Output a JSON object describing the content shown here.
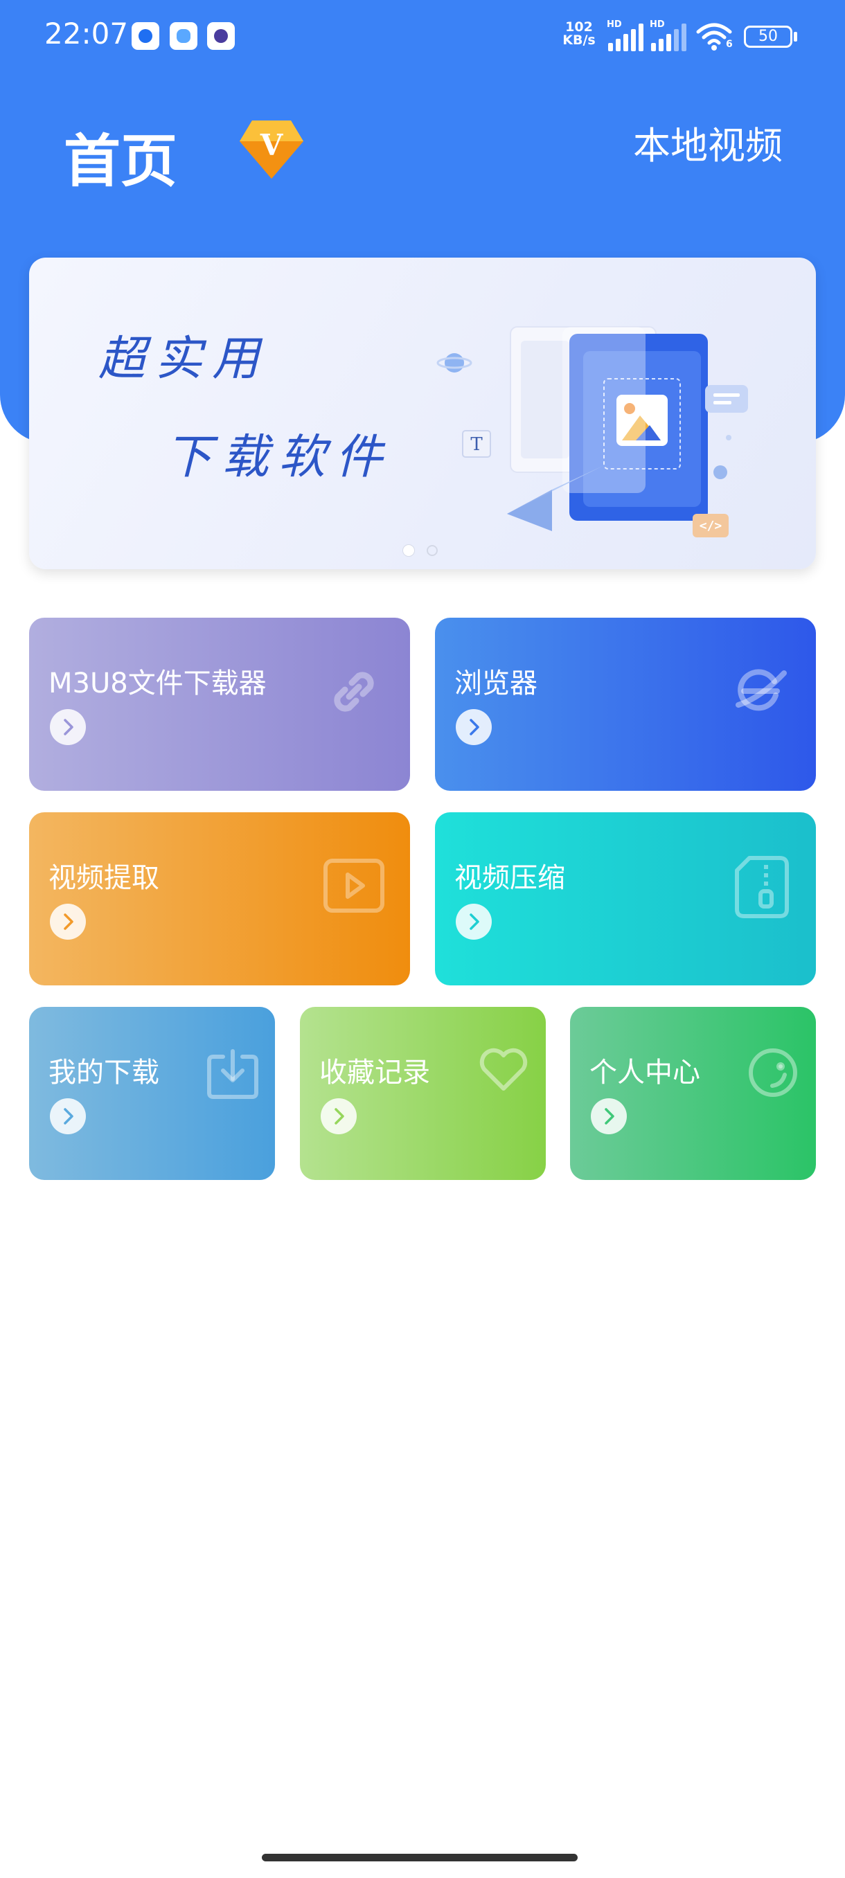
{
  "status_bar": {
    "time": "22:07",
    "net_speed_value": "102",
    "net_speed_unit": "KB/s",
    "sim1_label": "HD",
    "sim2_label": "HD",
    "wifi_label": "6",
    "battery": "50",
    "app_icons": [
      "blue-circle-app-icon",
      "cloud-app-icon",
      "purple-app-icon"
    ]
  },
  "header": {
    "title": "首页",
    "vip_label": "V",
    "local_video_label": "本地视频"
  },
  "banner": {
    "line1": "超实用",
    "line2": "下载软件",
    "art_t_label": "T",
    "art_code_label": "</>",
    "page_count": 2,
    "active_page": 1
  },
  "cards": {
    "m3u8": {
      "label": "M3U8文件下载器",
      "icon": "link-icon"
    },
    "browser": {
      "label": "浏览器",
      "icon": "browser-icon"
    },
    "extract": {
      "label": "视频提取",
      "icon": "play-icon"
    },
    "compress": {
      "label": "视频压缩",
      "icon": "zip-icon"
    },
    "downloads": {
      "label": "我的下载",
      "icon": "download-icon"
    },
    "favorites": {
      "label": "收藏记录",
      "icon": "heart-icon"
    },
    "profile": {
      "label": "个人中心",
      "icon": "smile-icon"
    }
  },
  "colors": {
    "primary": "#3b82f6",
    "m3u8": [
      "#b1aedf",
      "#8c85d3"
    ],
    "browser": [
      "#4a90ed",
      "#2e58ea"
    ],
    "extract": [
      "#f3b660",
      "#f08d0e"
    ],
    "compress": [
      "#1fe0da",
      "#1bbfcc"
    ],
    "downloads": [
      "#7fbadf",
      "#4aa0dd"
    ],
    "favorites": [
      "#b4e28f",
      "#87d146"
    ],
    "profile": [
      "#6ccb98",
      "#2bc467"
    ]
  }
}
